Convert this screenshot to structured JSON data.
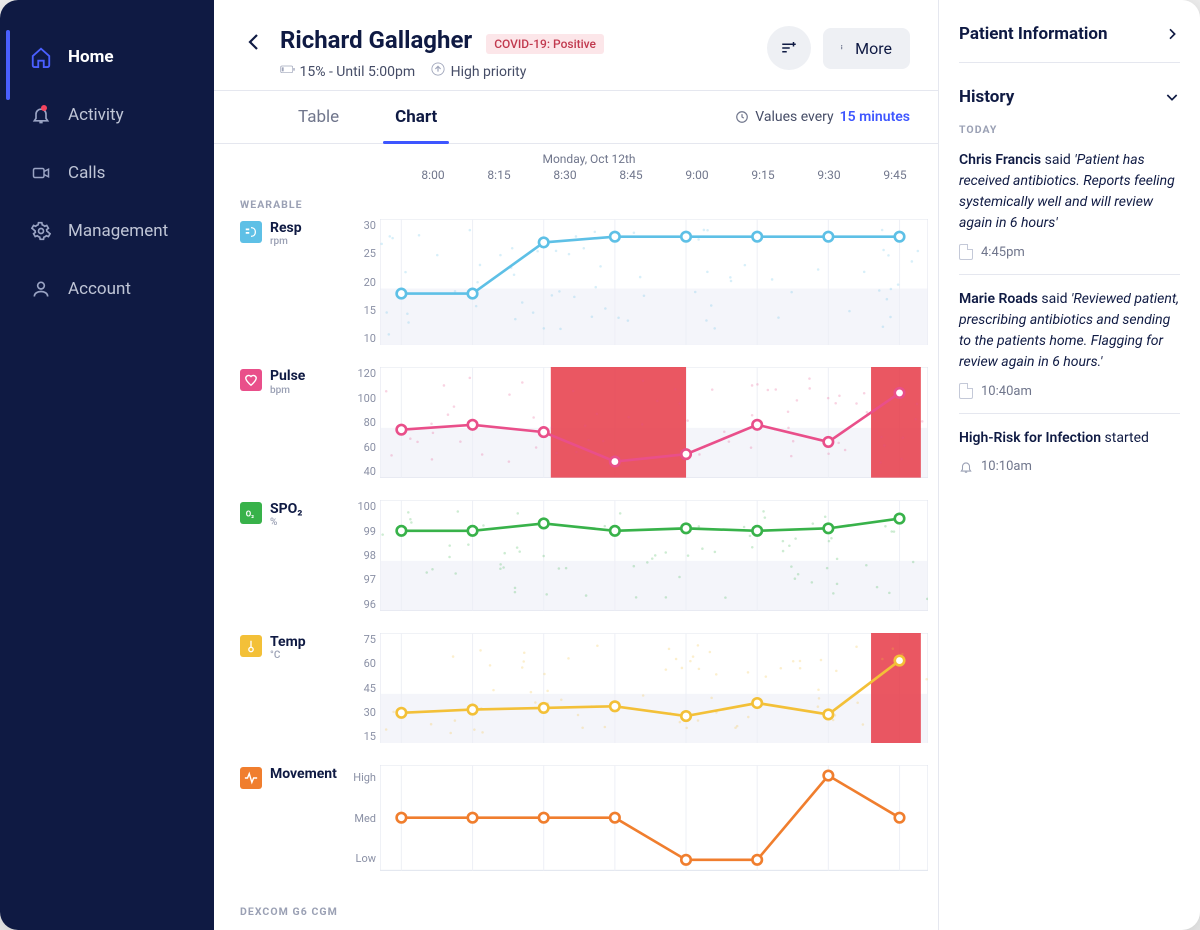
{
  "sidebar": {
    "items": [
      {
        "label": "Home",
        "icon": "home-icon",
        "active": true
      },
      {
        "label": "Activity",
        "icon": "bell-icon"
      },
      {
        "label": "Calls",
        "icon": "camera-icon"
      },
      {
        "label": "Management",
        "icon": "gear-icon"
      },
      {
        "label": "Account",
        "icon": "person-icon"
      }
    ]
  },
  "header": {
    "patient_name": "Richard Gallagher",
    "covid_badge": "COVID-19: Positive",
    "battery_status": "15% - Until 5:00pm",
    "priority": "High priority",
    "more_label": "More",
    "filter_icon": "filter-icon"
  },
  "tabs": {
    "items": [
      "Table",
      "Chart"
    ],
    "active": 1,
    "values_every_prefix": "Values every",
    "values_every_value": "15 minutes"
  },
  "chart_meta": {
    "date": "Monday, Oct 12th",
    "time_labels": [
      "8:00",
      "8:15",
      "8:30",
      "8:45",
      "9:00",
      "9:15",
      "9:30",
      "9:45"
    ],
    "section_wearable": "WEARABLE",
    "section_dexcom": "DEXCOM G6 CGM"
  },
  "metrics": [
    {
      "key": "resp",
      "name": "Resp",
      "unit": "rpm"
    },
    {
      "key": "pulse",
      "name": "Pulse",
      "unit": "bpm"
    },
    {
      "key": "spo2",
      "name": "SPO₂",
      "unit": "%"
    },
    {
      "key": "temp",
      "name": "Temp",
      "unit": "°C"
    },
    {
      "key": "move",
      "name": "Movement",
      "unit": ""
    }
  ],
  "chart_data": [
    {
      "type": "line",
      "key": "resp",
      "title": "Resp",
      "xlabel": "",
      "ylabel": "rpm",
      "ylim": [
        10,
        30
      ],
      "yticks": [
        10,
        15,
        20,
        25,
        30
      ],
      "x": [
        0,
        1,
        2,
        3,
        4,
        5,
        6,
        7
      ],
      "values": [
        18,
        18,
        27,
        28,
        28,
        28,
        28,
        28
      ],
      "color": "#5EC0E6"
    },
    {
      "type": "line",
      "key": "pulse",
      "title": "Pulse",
      "xlabel": "",
      "ylabel": "bpm",
      "ylim": [
        40,
        120
      ],
      "yticks": [
        40,
        60,
        80,
        100,
        120
      ],
      "x": [
        0,
        1,
        2,
        3,
        4,
        5,
        6,
        7
      ],
      "values": [
        74,
        78,
        72,
        48,
        54,
        78,
        64,
        104
      ],
      "color": "#E94F8A",
      "alert_bands": [
        [
          2.1,
          4.0
        ],
        [
          6.6,
          7.3
        ]
      ]
    },
    {
      "type": "line",
      "key": "spo2",
      "title": "SPO₂",
      "xlabel": "",
      "ylabel": "%",
      "ylim": [
        96,
        100
      ],
      "yticks": [
        96,
        97,
        98,
        99,
        100
      ],
      "x": [
        0,
        1,
        2,
        3,
        4,
        5,
        6,
        7
      ],
      "values": [
        99,
        99,
        99.3,
        99,
        99.1,
        99,
        99.1,
        99.5
      ],
      "color": "#38B24A"
    },
    {
      "type": "line",
      "key": "temp",
      "title": "Temp",
      "xlabel": "",
      "ylabel": "°C",
      "ylim": [
        15,
        75
      ],
      "yticks": [
        15,
        30,
        45,
        60,
        75
      ],
      "x": [
        0,
        1,
        2,
        3,
        4,
        5,
        6,
        7
      ],
      "values": [
        30,
        32,
        33,
        34,
        28,
        36,
        29,
        62
      ],
      "color": "#F3C038",
      "alert_bands": [
        [
          6.6,
          7.3
        ]
      ]
    },
    {
      "type": "line",
      "key": "move",
      "title": "Movement",
      "xlabel": "",
      "ylabel": "",
      "ylim": [
        0,
        2
      ],
      "yticks_cat": [
        "Low",
        "Med",
        "High"
      ],
      "x": [
        0,
        1,
        2,
        3,
        4,
        5,
        6,
        7
      ],
      "values": [
        1,
        1,
        1,
        1,
        0,
        0,
        2,
        1
      ],
      "color": "#F07E2E"
    }
  ],
  "right_panel": {
    "patient_info_label": "Patient Information",
    "history_label": "History",
    "today_label": "TODAY",
    "entries": [
      {
        "author": "Chris Francis",
        "said": " said ",
        "quote": "'Patient has received antibiotics. Reports feeling systemically well and will review again in 6 hours'",
        "time": "4:45pm",
        "icon": "doc"
      },
      {
        "author": "Marie Roads",
        "said": " said ",
        "quote": "'Reviewed patient, prescribing antibiotics and sending to the patients home. Flagging for review again in 6 hours.'",
        "time": "10:40am",
        "icon": "doc"
      },
      {
        "author": "High-Risk for Infection",
        "said": " started",
        "quote": "",
        "time": "10:10am",
        "icon": "bell"
      }
    ]
  }
}
